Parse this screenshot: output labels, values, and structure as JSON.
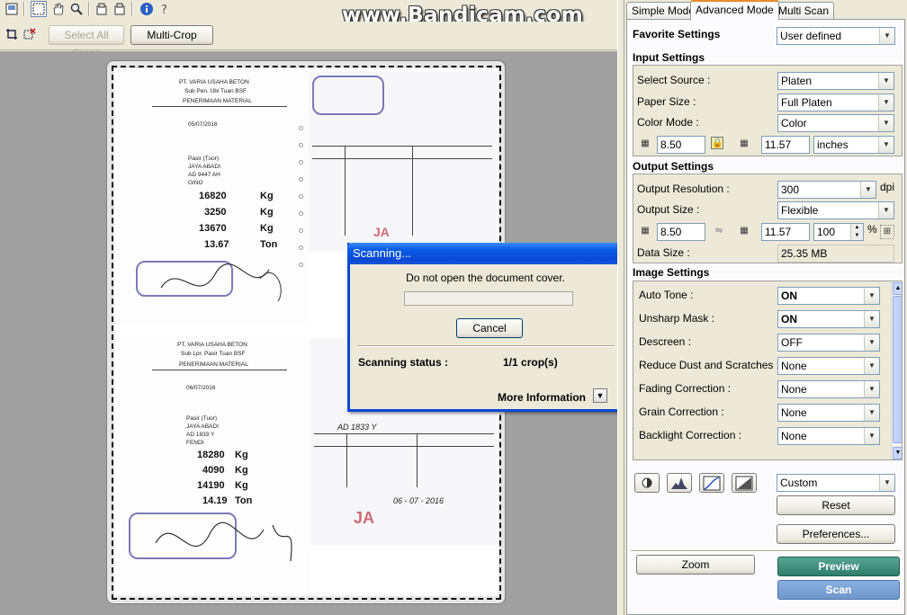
{
  "watermark": "www.Bandicam.com",
  "toolbar": {
    "select_all_crops": "Select All Crops",
    "multi_crop": "Multi-Crop"
  },
  "dialog": {
    "title": "Scanning...",
    "message": "Do not open the document cover.",
    "cancel": "Cancel",
    "status_label": "Scanning status :",
    "status_value": "1/1 crop(s)",
    "more_info": "More Information",
    "progress": 0
  },
  "tabs": [
    "Simple Mode",
    "Advanced Mode",
    "Multi Scan"
  ],
  "favorite": {
    "label": "Favorite Settings",
    "value": "User defined"
  },
  "input_settings": {
    "title": "Input Settings",
    "select_source_label": "Select Source :",
    "select_source": "Platen",
    "paper_size_label": "Paper Size :",
    "paper_size": "Full Platen",
    "color_mode_label": "Color Mode :",
    "color_mode": "Color",
    "width": "8.50",
    "height": "11.57",
    "unit": "inches"
  },
  "output_settings": {
    "title": "Output Settings",
    "resolution_label": "Output Resolution :",
    "resolution": "300",
    "resolution_unit": "dpi",
    "size_label": "Output Size :",
    "size": "Flexible",
    "width": "8.50",
    "height": "11.57",
    "scale": "100",
    "scale_unit": "%",
    "data_size_label": "Data Size :",
    "data_size": "25.35 MB"
  },
  "image_settings": {
    "title": "Image Settings",
    "rows": [
      {
        "label": "Auto Tone :",
        "value": "ON",
        "bold": true
      },
      {
        "label": "Unsharp Mask :",
        "value": "ON",
        "bold": true
      },
      {
        "label": "Descreen :",
        "value": "OFF",
        "bold": false
      },
      {
        "label": "Reduce Dust and Scratches :",
        "value": "None",
        "bold": false
      },
      {
        "label": "Fading Correction :",
        "value": "None",
        "bold": false
      },
      {
        "label": "Grain Correction :",
        "value": "None",
        "bold": false
      },
      {
        "label": "Backlight Correction :",
        "value": "None",
        "bold": false
      }
    ]
  },
  "tone": {
    "preset": "Custom",
    "reset": "Reset"
  },
  "buttons": {
    "preferences": "Preferences...",
    "zoom": "Zoom",
    "preview": "Preview",
    "scan": "Scan"
  },
  "document": {
    "top": {
      "company": "PT. VARIA USAHA BETON",
      "plant": "Sub Pen. Ubi Tuan BSF",
      "receipt": "PENERIMAAN MATERIAL",
      "date": "05/07/2016",
      "material": "Pasir (Tuor)",
      "supplier": "JAYA ABADI",
      "nopol": "AD 9447 AH",
      "sopir": "GINO",
      "gross": "16820",
      "tare": "3250",
      "net": "13670",
      "tons": "13.67",
      "kg": "Kg",
      "ton": "Ton"
    },
    "bottom": {
      "company": "PT. VARIA USAHA BETON",
      "plant": "Sub Lpr. Pasir Tuan BSF",
      "receipt": "PENERIMAAN MATERIAL",
      "date": "06/07/2016",
      "material": "Pasir (Tuor)",
      "supplier": "JAYA ABADI",
      "nopol": "AD 1833 Y",
      "sopir": "FENDI",
      "gross": "18280",
      "tare": "4090",
      "net": "14190",
      "tons": "14.19",
      "kg": "Kg",
      "ton": "Ton",
      "handwritten_plate": "AD 1833 Y",
      "handwritten_date": "06 - 07 - 2016"
    }
  }
}
